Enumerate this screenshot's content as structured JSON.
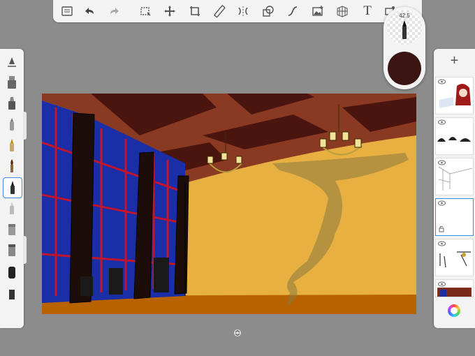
{
  "toolbar": {
    "tools": [
      {
        "name": "gallery-icon"
      },
      {
        "name": "undo-icon"
      },
      {
        "name": "redo-icon"
      },
      {
        "name": "selection-icon"
      },
      {
        "name": "transform-icon"
      },
      {
        "name": "crop-icon"
      },
      {
        "name": "ruler-icon"
      },
      {
        "name": "symmetry-icon"
      },
      {
        "name": "shape-icon"
      },
      {
        "name": "stroke-icon"
      },
      {
        "name": "add-image-icon"
      },
      {
        "name": "perspective-grid-icon"
      },
      {
        "name": "text-icon"
      },
      {
        "name": "fill-icon"
      }
    ],
    "text_tool_glyph": "T"
  },
  "brush_puck": {
    "size": "42.5",
    "color": "#3a1512"
  },
  "brush_palette": {
    "brushes": [
      "pencil",
      "marker-wide",
      "marker",
      "airbrush",
      "ink-pen",
      "paintbrush",
      "brush-pen",
      "eraser-tip",
      "chisel",
      "chisel-2",
      "round-marker",
      "block"
    ],
    "selected_brush": "brush-pen"
  },
  "layer_panel": {
    "add_label": "+",
    "layers": [
      {
        "name": "character",
        "visible": true
      },
      {
        "name": "chandeliers",
        "visible": true
      },
      {
        "name": "line-art",
        "visible": true
      },
      {
        "name": "empty-selected",
        "visible": true,
        "selected": true,
        "locked": true
      },
      {
        "name": "props",
        "visible": true
      },
      {
        "name": "background",
        "visible": true
      }
    ]
  },
  "colors": {
    "app_background": "#8c8c8c",
    "panel": "#f3f3f3",
    "accent": "#3a8de0",
    "wall": "#e8b040",
    "floor": "#b86200",
    "ceiling": "#8a3a22",
    "ceiling_panel": "#4a140f",
    "window": "#1a2ea8"
  }
}
